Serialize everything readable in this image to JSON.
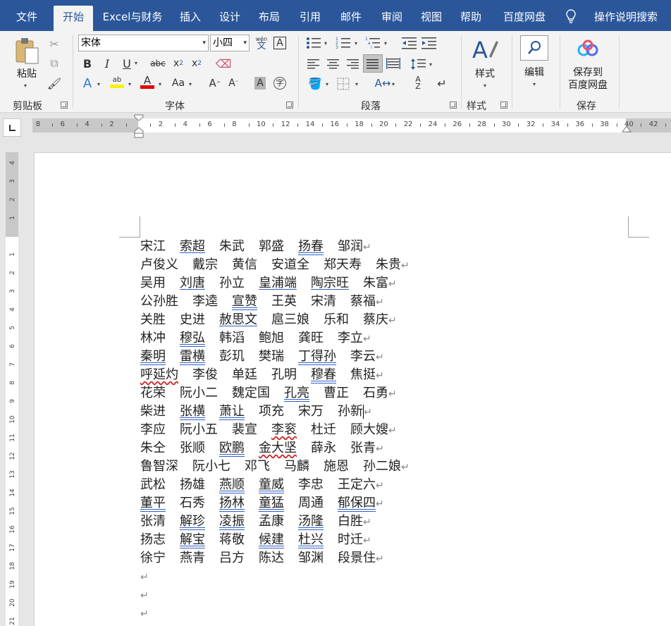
{
  "tabs": [
    "文件",
    "开始",
    "Excel与财务",
    "插入",
    "设计",
    "布局",
    "引用",
    "邮件",
    "审阅",
    "视图",
    "帮助",
    "百度网盘",
    "操作说明搜索"
  ],
  "ribbon": {
    "clipboard": {
      "paste": "粘贴",
      "label": "剪贴板"
    },
    "font": {
      "name": "宋体",
      "size": "小四",
      "label": "字体",
      "pinyin_glyph": "wén"
    },
    "paragraph": {
      "label": "段落"
    },
    "styles": {
      "button": "样式",
      "label": "样式"
    },
    "editing": {
      "button": "编辑"
    },
    "save": {
      "button_line1": "保存到",
      "button_line2": "百度网盘",
      "label": "保存"
    }
  },
  "ruler_numbers": [
    "8",
    "6",
    "4",
    "2",
    "",
    "2",
    "4",
    "6",
    "8",
    "10",
    "12",
    "14",
    "16",
    "18",
    "20",
    "22",
    "24",
    "26",
    "28",
    "30",
    "32",
    "34",
    "36",
    "38",
    "40",
    "42"
  ],
  "vruler_numbers": [
    "4",
    "3",
    "2",
    "1",
    "",
    "1",
    "2",
    "3",
    "4",
    "5",
    "6",
    "7",
    "8",
    "9",
    "10",
    "11",
    "12",
    "13",
    "14",
    "15",
    "16",
    "17",
    "18",
    "19",
    "20",
    "21"
  ],
  "document": {
    "lines": [
      [
        {
          "t": "宋江"
        },
        {
          "t": "索超",
          "u": "u1"
        },
        {
          "t": "朱武"
        },
        {
          "t": "郭盛"
        },
        {
          "t": "扬春",
          "u": "u2"
        },
        {
          "t": "邹润"
        }
      ],
      [
        {
          "t": "卢俊义"
        },
        {
          "t": "戴宗"
        },
        {
          "t": "黄信"
        },
        {
          "t": "安道全"
        },
        {
          "t": "郑天寿"
        },
        {
          "t": "朱贵"
        }
      ],
      [
        {
          "t": "吴用"
        },
        {
          "t": "刘唐",
          "u": "u1"
        },
        {
          "t": "孙立"
        },
        {
          "t": "皇浦端",
          "u": "u1"
        },
        {
          "t": "陶宗旺",
          "u": "u1"
        },
        {
          "t": "朱富"
        }
      ],
      [
        {
          "t": "公孙胜"
        },
        {
          "t": "李逵"
        },
        {
          "t": "宣赞",
          "u": "u2"
        },
        {
          "t": "王英"
        },
        {
          "t": "宋清"
        },
        {
          "t": "蔡福"
        }
      ],
      [
        {
          "t": "关胜"
        },
        {
          "t": "史进"
        },
        {
          "t": "赦思文",
          "u": "u1"
        },
        {
          "t": "扈三娘"
        },
        {
          "t": "乐和"
        },
        {
          "t": "蔡庆"
        }
      ],
      [
        {
          "t": "林冲"
        },
        {
          "t": "穆弘",
          "u": "u2"
        },
        {
          "t": "韩滔"
        },
        {
          "t": "鲍旭"
        },
        {
          "t": "龚旺"
        },
        {
          "t": "李立"
        }
      ],
      [
        {
          "t": "秦明",
          "u": "u2"
        },
        {
          "t": "雷横",
          "u": "u2"
        },
        {
          "t": "彭玑"
        },
        {
          "t": "樊瑞"
        },
        {
          "t": "丁得孙",
          "u": "u2"
        },
        {
          "t": "李云"
        }
      ],
      [
        {
          "t": "呼延灼",
          "u": "sq"
        },
        {
          "t": "李俊"
        },
        {
          "t": "单廷"
        },
        {
          "t": "孔明"
        },
        {
          "t": "穆春",
          "u": "u2"
        },
        {
          "t": "焦挺"
        }
      ],
      [
        {
          "t": "花荣"
        },
        {
          "t": "阮小二"
        },
        {
          "t": "魏定国"
        },
        {
          "t": "孔亮",
          "u": "u2"
        },
        {
          "t": "曹正"
        },
        {
          "t": "石勇"
        }
      ],
      [
        {
          "t": "柴进"
        },
        {
          "t": "张横",
          "u": "u2"
        },
        {
          "t": "萧让",
          "u": "u2"
        },
        {
          "t": "项充"
        },
        {
          "t": "宋万"
        },
        {
          "t": "孙新",
          "caret": true
        }
      ],
      [
        {
          "t": "李应"
        },
        {
          "t": "阮小五"
        },
        {
          "t": "裴宣"
        },
        {
          "t": "李衮",
          "u": "sq"
        },
        {
          "t": "杜迁"
        },
        {
          "t": "顾大嫂"
        }
      ],
      [
        {
          "t": "朱仝"
        },
        {
          "t": "张顺"
        },
        {
          "t": "欧鹏",
          "u": "u2"
        },
        {
          "t": "金大坚",
          "u": "sq"
        },
        {
          "t": "薛永"
        },
        {
          "t": "张青"
        }
      ],
      [
        {
          "t": "鲁智深"
        },
        {
          "t": "阮小七"
        },
        {
          "t": "邓飞"
        },
        {
          "t": "马麟"
        },
        {
          "t": "施恩"
        },
        {
          "t": "孙二娘"
        }
      ],
      [
        {
          "t": "武松"
        },
        {
          "t": "扬雄"
        },
        {
          "t": "燕顺",
          "u": "u2"
        },
        {
          "t": "童威",
          "u": "u2"
        },
        {
          "t": "李忠"
        },
        {
          "t": "王定六"
        }
      ],
      [
        {
          "t": "董平",
          "u": "u2"
        },
        {
          "t": "石秀"
        },
        {
          "t": "扬林",
          "u": "u2"
        },
        {
          "t": "童猛",
          "u": "u2"
        },
        {
          "t": "周通"
        },
        {
          "t": "郁保四",
          "u": "u2"
        }
      ],
      [
        {
          "t": "张清"
        },
        {
          "t": "解珍",
          "u": "u2"
        },
        {
          "t": "凌振",
          "u": "u2"
        },
        {
          "t": "孟康"
        },
        {
          "t": "汤隆",
          "u": "u2"
        },
        {
          "t": "白胜"
        }
      ],
      [
        {
          "t": "扬志"
        },
        {
          "t": "解宝",
          "u": "u2"
        },
        {
          "t": "蒋敬"
        },
        {
          "t": "候建",
          "u": "u2"
        },
        {
          "t": "杜兴",
          "u": "u2"
        },
        {
          "t": "时迁"
        }
      ],
      [
        {
          "t": "徐宁"
        },
        {
          "t": "燕青"
        },
        {
          "t": "吕方"
        },
        {
          "t": "陈达"
        },
        {
          "t": "邹渊"
        },
        {
          "t": "段景住"
        }
      ],
      [],
      [],
      []
    ],
    "para_mark": "↵"
  },
  "colors": {
    "titlebar": "#2b579a",
    "underline": "#2f5fc4",
    "squiggle": "#d02020"
  }
}
